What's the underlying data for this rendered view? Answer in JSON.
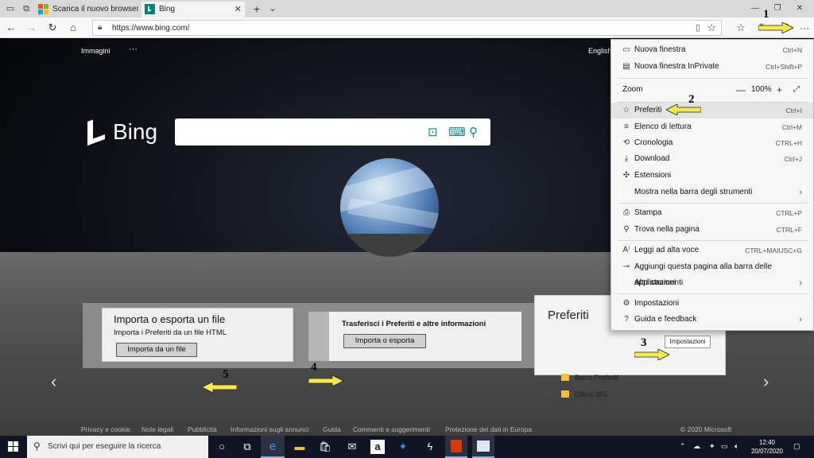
{
  "tabs": [
    {
      "label": "Scarica il nuovo browser Mi",
      "active": false
    },
    {
      "label": "Bing",
      "active": true
    }
  ],
  "window_icons": [
    "tab-preview-icon",
    "tab-set-icon",
    "new-tab-plus",
    "tab-list-chevron"
  ],
  "address_bar": {
    "url": "https://www.bing.com/"
  },
  "bing": {
    "logo_text": "Bing",
    "top_links": {
      "images": "Immagini",
      "more": "···",
      "language": "English"
    },
    "collapse_glyph": "⌄"
  },
  "menu": {
    "items": [
      {
        "label": "Nuova finestra",
        "shortcut": "Ctrl+N",
        "icon": "new-window-icon"
      },
      {
        "label": "Nuova finestra InPrivate",
        "shortcut": "Ctrl+Shift+P",
        "icon": "inprivate-icon"
      },
      {
        "label": "Preferiti",
        "shortcut": "Ctrl+I",
        "icon": "favorites-icon"
      },
      {
        "label": "Elenco di lettura",
        "shortcut": "Ctrl+M",
        "icon": "reading-list-icon"
      },
      {
        "label": "Cronologia",
        "shortcut": "CTRL+H",
        "icon": "history-icon"
      },
      {
        "label": "Download",
        "shortcut": "Ctrl+J",
        "icon": "download-icon"
      },
      {
        "label": "Estensioni",
        "shortcut": "",
        "icon": "extensions-icon"
      },
      {
        "label": "Mostra nella barra degli strumenti",
        "shortcut": "",
        "icon": ""
      },
      {
        "label": "Stampa",
        "shortcut": "CTRL+P",
        "icon": "print-icon"
      },
      {
        "label": "Trova nella pagina",
        "shortcut": "CTRL+F",
        "icon": "find-icon"
      },
      {
        "label": "Leggi ad alta voce",
        "shortcut": "CTRL+MAIUSC+G",
        "icon": "read-aloud-icon"
      },
      {
        "label": "Aggiungi questa pagina alla barra delle applicazioni",
        "shortcut": "",
        "icon": "pin-icon"
      },
      {
        "label": "Altri strumenti",
        "shortcut": "",
        "icon": ""
      },
      {
        "label": "Impostazioni",
        "shortcut": "",
        "icon": "settings-icon"
      },
      {
        "label": "Guida e feedback",
        "shortcut": "",
        "icon": "help-icon"
      }
    ],
    "zoom": {
      "label": "Zoom",
      "value": "100%",
      "minus": "—",
      "plus": "+"
    }
  },
  "import": {
    "file_title": "Importa o esporta un file",
    "file_sub": "Importa i Preferiti da un file HTML",
    "file_button": "Importa da un file",
    "transfer_title": "Trasferisci i Preferiti e altre informazioni",
    "transfer_button": "Importa o esporta"
  },
  "favorites_panel": {
    "title": "Preferiti",
    "tooltip": "Impostazioni",
    "items": [
      "Barra Preferiti",
      "Office 365"
    ]
  },
  "footer": [
    "Privacy e cookie",
    "Note legali",
    "Pubblicità",
    "Informazioni sugli annunci",
    "Guida",
    "Commenti e suggerimenti",
    "Protezione dei dati in Europa",
    "© 2020 Microsoft"
  ],
  "annotations": [
    "1",
    "2",
    "3",
    "4",
    "5"
  ],
  "taskbar": {
    "search_placeholder": "Scrivi qui per eseguire la ricerca",
    "time": "12:40",
    "date": "20/07/2020"
  },
  "colors": {
    "arrow": "#f5e94a",
    "accent": "#0c8484",
    "menu_highlight": "#e3e3e3"
  }
}
